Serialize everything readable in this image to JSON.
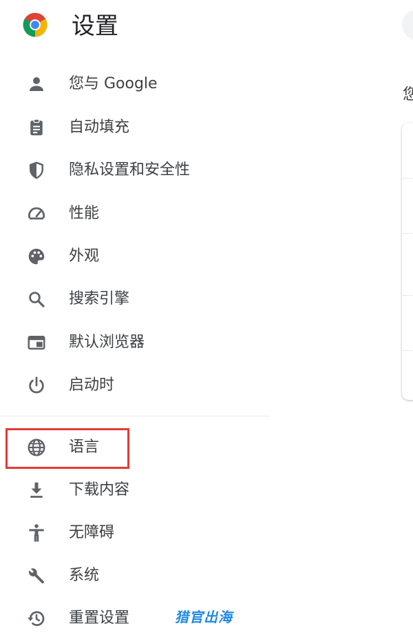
{
  "header": {
    "title": "设置"
  },
  "nav": {
    "items": [
      {
        "label": "您与 Google",
        "icon": "person-icon"
      },
      {
        "label": "自动填充",
        "icon": "clipboard-icon"
      },
      {
        "label": "隐私设置和安全性",
        "icon": "shield-icon"
      },
      {
        "label": "性能",
        "icon": "speedometer-icon"
      },
      {
        "label": "外观",
        "icon": "palette-icon"
      },
      {
        "label": "搜索引擎",
        "icon": "search-icon"
      },
      {
        "label": "默认浏览器",
        "icon": "browser-window-icon"
      },
      {
        "label": "启动时",
        "icon": "power-icon"
      },
      {
        "label": "语言",
        "icon": "globe-icon",
        "highlighted": true
      },
      {
        "label": "下载内容",
        "icon": "download-icon"
      },
      {
        "label": "无障碍",
        "icon": "accessibility-icon"
      },
      {
        "label": "系统",
        "icon": "wrench-icon"
      },
      {
        "label": "重置设置",
        "icon": "history-reset-icon"
      }
    ]
  },
  "main": {
    "partial_heading": "您"
  },
  "watermark": "猎官出海",
  "colors": {
    "highlight": "#e53935",
    "icon": "#5f6368",
    "watermark": "#1e88e5"
  }
}
